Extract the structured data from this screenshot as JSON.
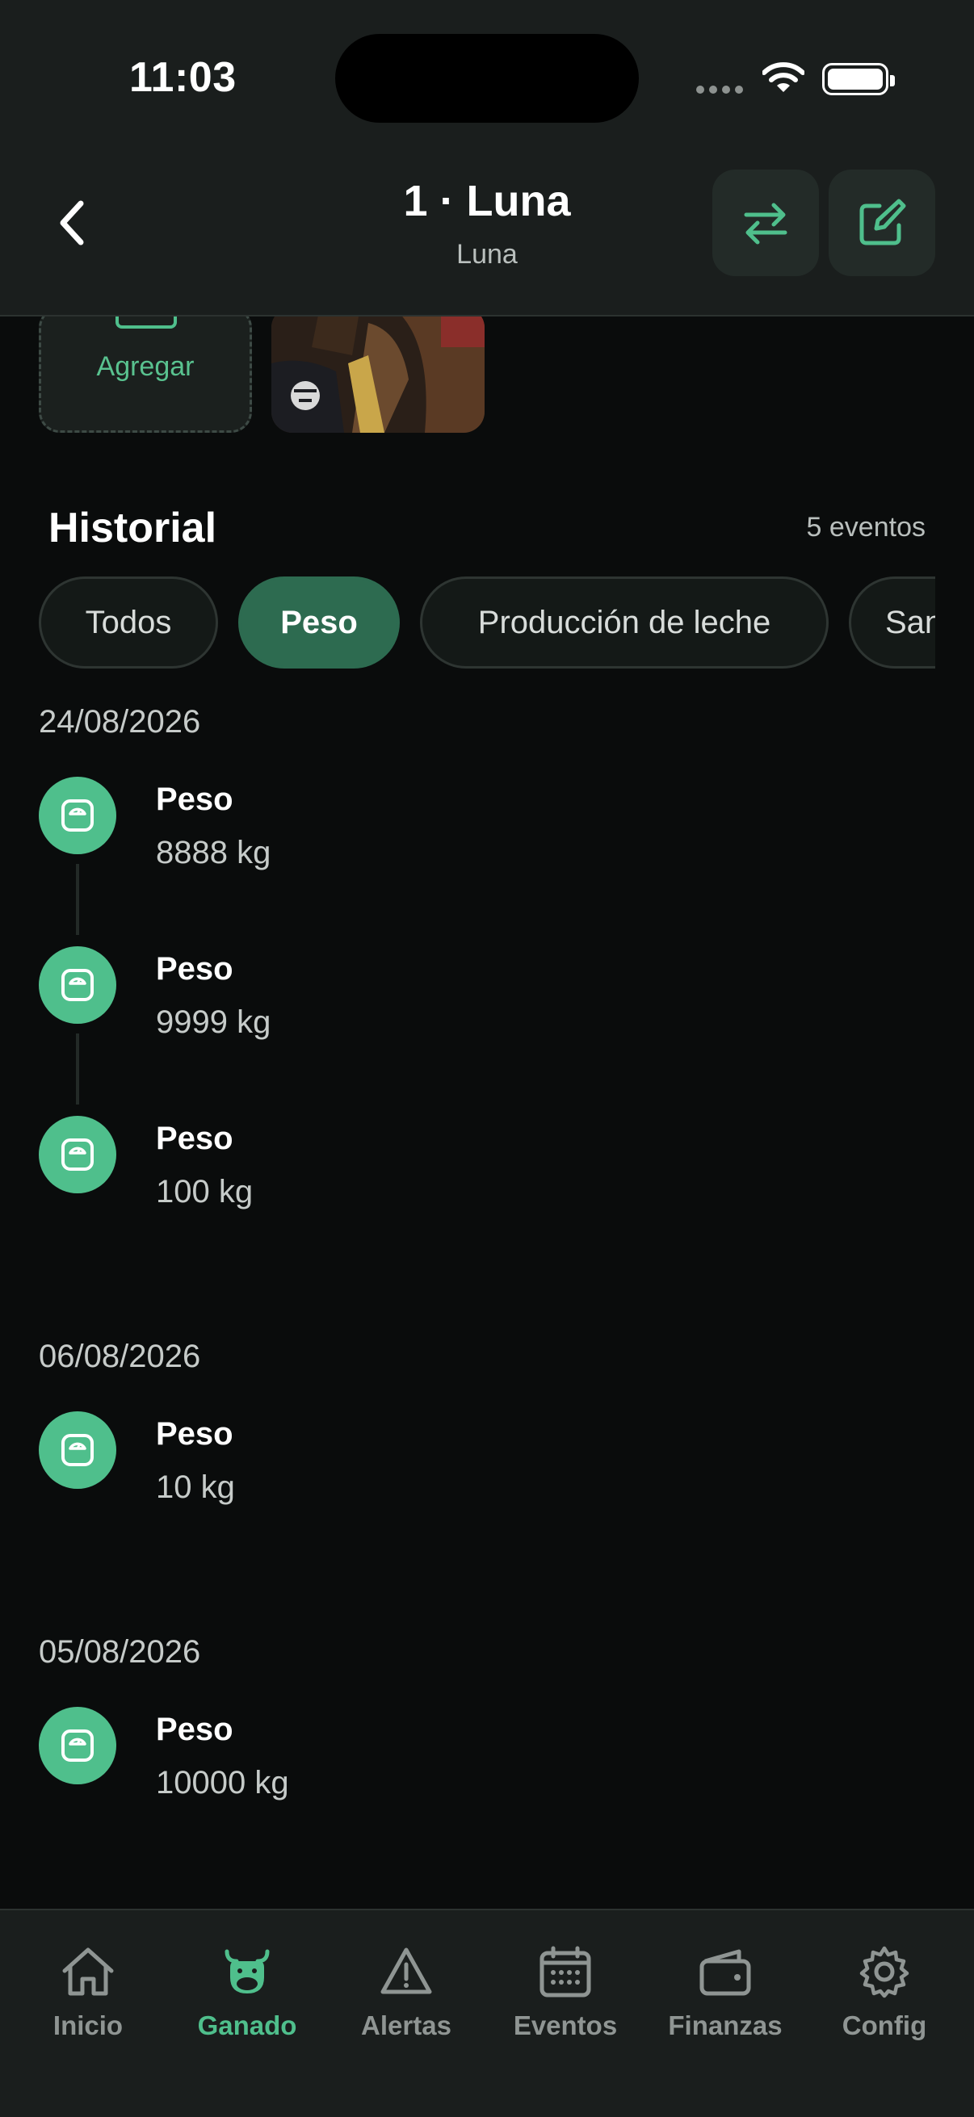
{
  "status_bar": {
    "time": "11:03"
  },
  "header": {
    "title": "1 · Luna",
    "subtitle": "Luna"
  },
  "photos": {
    "add_label": "Agregar"
  },
  "historial": {
    "title": "Historial",
    "count": "5 eventos",
    "filters": [
      "Todos",
      "Peso",
      "Producción de leche",
      "Sanidad"
    ],
    "active_filter": "Peso",
    "groups": [
      {
        "date": "24/08/2026",
        "events": [
          {
            "title": "Peso",
            "value": "8888 kg",
            "icon": "scale-icon"
          },
          {
            "title": "Peso",
            "value": "9999 kg",
            "icon": "scale-icon"
          },
          {
            "title": "Peso",
            "value": "100 kg",
            "icon": "scale-icon"
          }
        ]
      },
      {
        "date": "06/08/2026",
        "events": [
          {
            "title": "Peso",
            "value": "10 kg",
            "icon": "scale-icon"
          }
        ]
      },
      {
        "date": "05/08/2026",
        "events": [
          {
            "title": "Peso",
            "value": "10000 kg",
            "icon": "scale-icon"
          }
        ]
      }
    ]
  },
  "tabbar": {
    "items": [
      {
        "label": "Inicio",
        "icon": "home-icon"
      },
      {
        "label": "Ganado",
        "icon": "cow-icon"
      },
      {
        "label": "Alertas",
        "icon": "warning-icon"
      },
      {
        "label": "Eventos",
        "icon": "calendar-icon"
      },
      {
        "label": "Finanzas",
        "icon": "wallet-icon"
      },
      {
        "label": "Config",
        "icon": "gear-icon"
      }
    ],
    "active": "Ganado"
  },
  "colors": {
    "accent": "#4fbf8c",
    "chip_active": "#2d6b50",
    "background": "#0a0c0c",
    "bar": "#1a1e1d"
  }
}
